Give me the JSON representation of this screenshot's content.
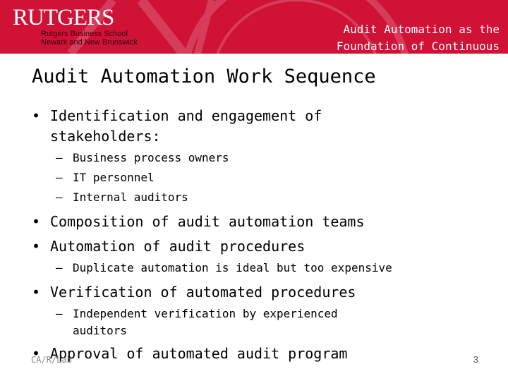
{
  "header": {
    "logo_text": "RUTGERS",
    "logo_sub1": "Rutgers Business School",
    "logo_sub2": "Newark and New Brunswick",
    "title_line1": "Audit Automation as the",
    "title_line2": "Foundation of Continuous",
    "color": "#cf1236"
  },
  "slide": {
    "title": "Audit Automation Work Sequence",
    "bullets": [
      {
        "text": "Identification and engagement of stakeholders:",
        "sub": [
          "Business process owners",
          "IT personnel",
          "Internal auditors"
        ]
      },
      {
        "text": "Composition of audit automation teams",
        "sub": []
      },
      {
        "text": "Automation of audit procedures",
        "sub": [
          "Duplicate automation is ideal but too expensive"
        ]
      },
      {
        "text": "Verification of automated procedures",
        "sub": [
          "Independent verification by experienced auditors"
        ]
      },
      {
        "text": "Approval of automated audit program",
        "sub": []
      }
    ],
    "footer": "CA/R/Lab",
    "page_number": "3"
  }
}
